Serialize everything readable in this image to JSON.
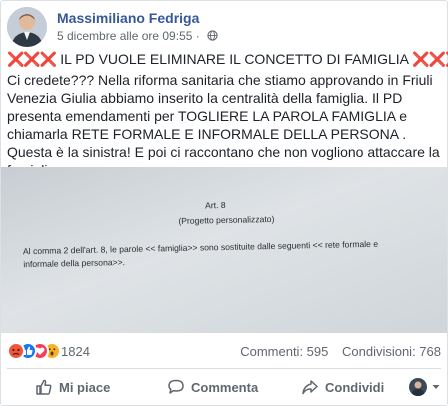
{
  "post": {
    "author": "Massimiliano Fedriga",
    "timestamp": "5 dicembre alle ore 09:55",
    "audience_icon": "globe-icon",
    "headline": "IL PD VUOLE ELIMINARE IL CONCETTO DI FAMIGLIA",
    "headline_marker": "❌❌❌",
    "body": "Ci credete??? Nella riforma sanitaria che stiamo approvando in Friuli Venezia Giulia abbiamo inserito la centralità della famiglia. Il PD presenta emendamenti per TOGLIERE LA PAROLA FAMIGLIA e chiamarla RETE FORMALE E INFORMALE DELLA PERSONA . Questa è la sinistra! E poi ci raccontano che non vogliono attaccare la famiglia..."
  },
  "photo": {
    "document_lines": [
      "Art. 8",
      "(Progetto personalizzato)",
      "Al comma 2 dell'art. 8,  le parole << famiglia>> sono sostituite dalle seguenti << rete formale e",
      "informale della persona>>."
    ]
  },
  "reactions": {
    "icons": [
      "angry-reaction",
      "like-reaction",
      "love-reaction",
      "wow-reaction"
    ],
    "count": "1824",
    "comments": "Commenti: 595",
    "shares": "Condivisioni: 768"
  },
  "actions": {
    "like": "Mi piace",
    "comment": "Commenta",
    "share": "Condividi"
  },
  "colors": {
    "author": "#365899",
    "meta": "#616770",
    "x_mark": "#dd2e44",
    "angry": "#f0563c",
    "like": "#1877f2",
    "love": "#f33e58",
    "wow": "#f7b125"
  }
}
